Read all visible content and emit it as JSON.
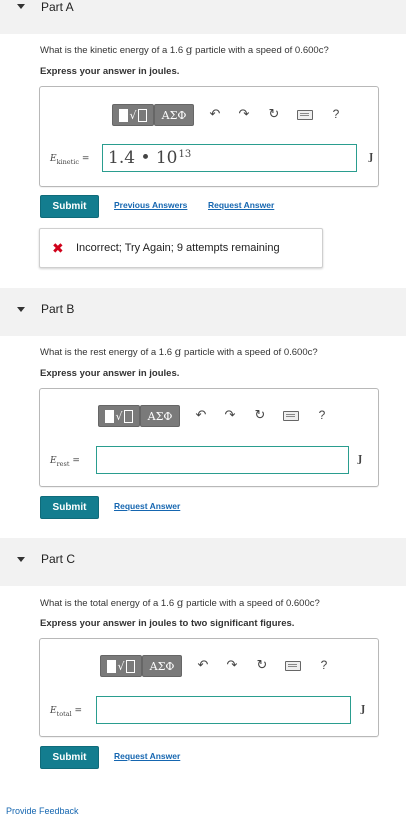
{
  "parts": [
    {
      "title": "Part A",
      "question": {
        "prefix": "What is the kinetic energy of a 1.6 ",
        "unit": "g",
        "suffix": " particle with a speed of 0.600c?"
      },
      "instruction": "Express your answer in joules.",
      "variable": {
        "symbol": "E",
        "subscript": "kinetic",
        "equals": "="
      },
      "input": {
        "mantissa": "1.4 • 10",
        "exponent": "13"
      },
      "unit": "J",
      "submit": "Submit",
      "links": [
        "Previous Answers",
        "Request Answer"
      ],
      "feedback": {
        "icon": "✖",
        "message": "Incorrect; Try Again; 9 attempts remaining"
      }
    },
    {
      "title": "Part B",
      "question": {
        "prefix": "What is the rest energy of a 1.6 ",
        "unit": "g",
        "suffix": " particle with a speed of 0.600c?"
      },
      "instruction": "Express your answer in joules.",
      "variable": {
        "symbol": "E",
        "subscript": "rest",
        "equals": "="
      },
      "input": {
        "mantissa": "",
        "exponent": ""
      },
      "unit": "J",
      "submit": "Submit",
      "links": [
        "Request Answer"
      ]
    },
    {
      "title": "Part C",
      "question": {
        "prefix": "What is the total energy of a 1.6 ",
        "unit": "g",
        "suffix": " particle with a speed of 0.600c?"
      },
      "instruction": "Express your answer in joules to two significant figures.",
      "variable": {
        "symbol": "E",
        "subscript": "total",
        "equals": "="
      },
      "input": {
        "mantissa": "",
        "exponent": ""
      },
      "unit": "J",
      "submit": "Submit",
      "links": [
        "Request Answer"
      ]
    }
  ],
  "toolbar": {
    "greek": "ΑΣΦ",
    "radical": "√",
    "undo": "↶",
    "redo": "↷",
    "reset": "↻",
    "help": "?",
    "icons": [
      "template-icon",
      "greek-symbols-icon",
      "undo-icon",
      "redo-icon",
      "reset-icon",
      "keyboard-icon",
      "help-icon"
    ]
  },
  "footer": {
    "link": "Provide Feedback"
  },
  "colors": {
    "accent": "#137d8f",
    "link": "#1566b0",
    "error": "#d0021b",
    "input_border": "#2a9d8f",
    "header_bg": "#f2f2f2"
  }
}
